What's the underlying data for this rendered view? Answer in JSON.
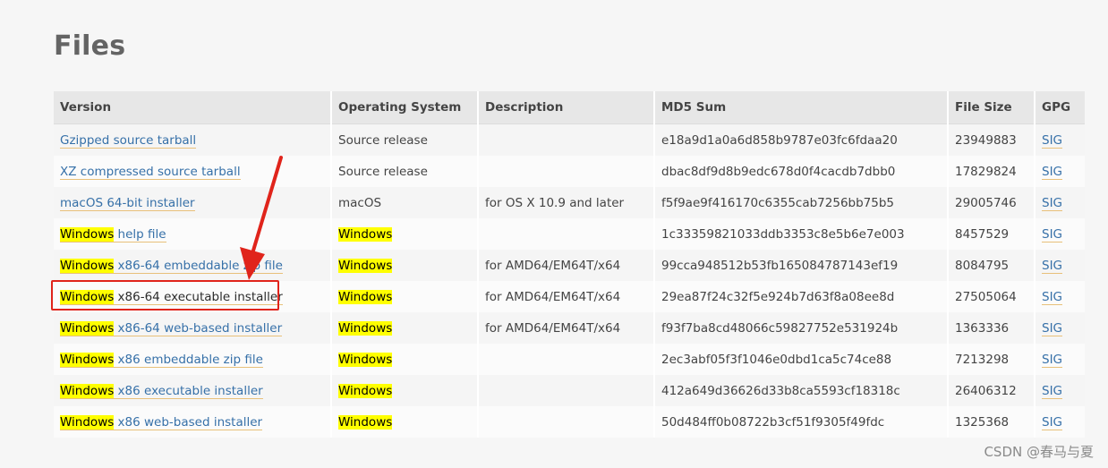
{
  "page": {
    "title": "Files",
    "watermark": "CSDN @春马与夏"
  },
  "table": {
    "headers": [
      "Version",
      "Operating System",
      "Description",
      "MD5 Sum",
      "File Size",
      "GPG"
    ],
    "rows": [
      {
        "prefix": "",
        "link_text": "Gzipped source tarball",
        "os": "Source release",
        "os_highlight": false,
        "description": "",
        "md5": "e18a9d1a0a6d858b9787e03fc6fdaa20",
        "size": "23949883",
        "gpg": "SIG"
      },
      {
        "prefix": "",
        "link_text": "XZ compressed source tarball",
        "os": "Source release",
        "os_highlight": false,
        "description": "",
        "md5": "dbac8df9d8b9edc678d0f4cacdb7dbb0",
        "size": "17829824",
        "gpg": "SIG"
      },
      {
        "prefix": "",
        "link_text": "macOS 64-bit installer",
        "os": "macOS",
        "os_highlight": false,
        "description": "for OS X 10.9 and later",
        "md5": "f5f9ae9f416170c6355cab7256bb75b5",
        "size": "29005746",
        "gpg": "SIG"
      },
      {
        "prefix": "Windows",
        "link_text": " help file",
        "os": "Windows",
        "os_highlight": true,
        "description": "",
        "md5": "1c33359821033ddb3353c8e5b6e7e003",
        "size": "8457529",
        "gpg": "SIG"
      },
      {
        "prefix": "Windows",
        "link_text": " x86-64 embeddable zip file",
        "os": "Windows",
        "os_highlight": true,
        "description": "for AMD64/EM64T/x64",
        "md5": "99cca948512b53fb165084787143ef19",
        "size": "8084795",
        "gpg": "SIG"
      },
      {
        "prefix": "Windows",
        "link_text": " x86-64 executable installer",
        "os": "Windows",
        "os_highlight": true,
        "description": "for AMD64/EM64T/x64",
        "md5": "29ea87f24c32f5e924b7d63f8a08ee8d",
        "size": "27505064",
        "gpg": "SIG",
        "selected": true
      },
      {
        "prefix": "Windows",
        "link_text": " x86-64 web-based installer",
        "os": "Windows",
        "os_highlight": true,
        "description": "for AMD64/EM64T/x64",
        "md5": "f93f7ba8cd48066c59827752e531924b",
        "size": "1363336",
        "gpg": "SIG"
      },
      {
        "prefix": "Windows",
        "link_text": " x86 embeddable zip file",
        "os": "Windows",
        "os_highlight": true,
        "description": "",
        "md5": "2ec3abf05f3f1046e0dbd1ca5c74ce88",
        "size": "7213298",
        "gpg": "SIG"
      },
      {
        "prefix": "Windows",
        "link_text": " x86 executable installer",
        "os": "Windows",
        "os_highlight": true,
        "description": "",
        "md5": "412a649d36626d33b8ca5593cf18318c",
        "size": "26406312",
        "gpg": "SIG"
      },
      {
        "prefix": "Windows",
        "link_text": " x86 web-based installer",
        "os": "Windows",
        "os_highlight": true,
        "description": "",
        "md5": "50d484ff0b08722b3cf51f9305f49fdc",
        "size": "1325368",
        "gpg": "SIG"
      }
    ]
  },
  "colors": {
    "link": "#3670a8",
    "highlight": "#ffff00",
    "annotation": "#e0241b"
  }
}
